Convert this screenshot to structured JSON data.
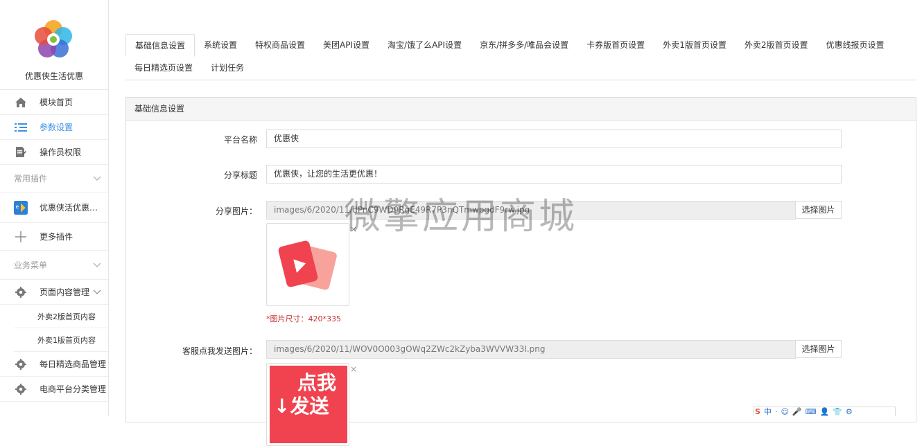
{
  "sidebar": {
    "brand_name": "优惠侠生活优惠",
    "nav": [
      {
        "label": "模块首页",
        "icon": "home-icon"
      },
      {
        "label": "参数设置",
        "icon": "list-settings-icon"
      },
      {
        "label": "操作员权限",
        "icon": "document-edit-icon"
      }
    ],
    "plugins_group": "常用插件",
    "plugins": [
      {
        "label": "优惠侠活优惠外…",
        "icon": "plugin-app-icon"
      },
      {
        "label": "更多插件",
        "icon": "plus-icon"
      }
    ],
    "business_group": "业务菜单",
    "business": {
      "page_content": "页面内容管理",
      "sub_items": [
        "外卖2版首页内容",
        "外卖1版首页内容"
      ],
      "daily_goods": "每日精选商品管理",
      "ecommerce_category": "电商平台分类管理"
    }
  },
  "tabs": [
    "基础信息设置",
    "系统设置",
    "特权商品设置",
    "美团API设置",
    "淘宝/饿了么API设置",
    "京东/拼多多/唯品会设置",
    "卡券版首页设置",
    "外卖1版首页设置",
    "外卖2版首页设置",
    "优惠线报页设置",
    "每日精选页设置",
    "计划任务"
  ],
  "active_tab": 0,
  "panel": {
    "title": "基础信息设置",
    "platform_name_label": "平台名称",
    "platform_name_value": "优惠侠",
    "share_title_label": "分享标题",
    "share_title_value": "优惠侠，让您的生活更优惠！",
    "share_image_label": "分享图片：",
    "share_image_value": "images/6/2020/11/dPnC9WD9RgE49R7P3nQTmwpgdF9rw.jpg",
    "select_image": "选择图片",
    "image_size_hint": "*图片尺寸：420*335",
    "service_image_label": "客服点我发送图片：",
    "service_image_value": "images/6/2020/11/WOV0O003gOWq2ZWc2kZyba3WVVW33I.png",
    "service_image_text_line1": "点我",
    "service_image_text_line2": "↓发送",
    "remove": "×"
  },
  "watermark": "微擎应用商城",
  "ime_bar": [
    "S",
    "中",
    "·",
    "☺",
    "🎤",
    "⌨",
    "👤",
    "👕",
    "⚙"
  ],
  "colors": {
    "accent": "#3a8ee6",
    "hint": "#c9302c",
    "brand_red": "#f0434f"
  }
}
